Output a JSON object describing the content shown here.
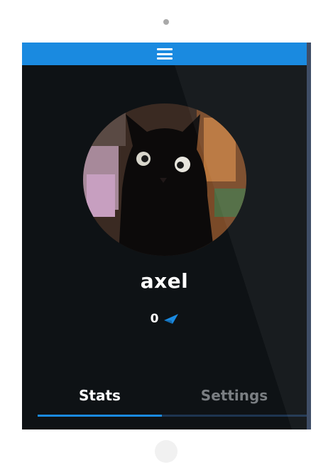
{
  "app": {
    "menu_icon": "hamburger-menu-icon",
    "accent_color": "#1a8ae0",
    "background_color": "#0e1215"
  },
  "profile": {
    "avatar_description": "black cat photo",
    "username": "axel",
    "points": "0",
    "points_icon": "paper-plane-icon"
  },
  "tabs": [
    {
      "label": "Stats",
      "active": true
    },
    {
      "label": "Settings",
      "active": false
    }
  ]
}
